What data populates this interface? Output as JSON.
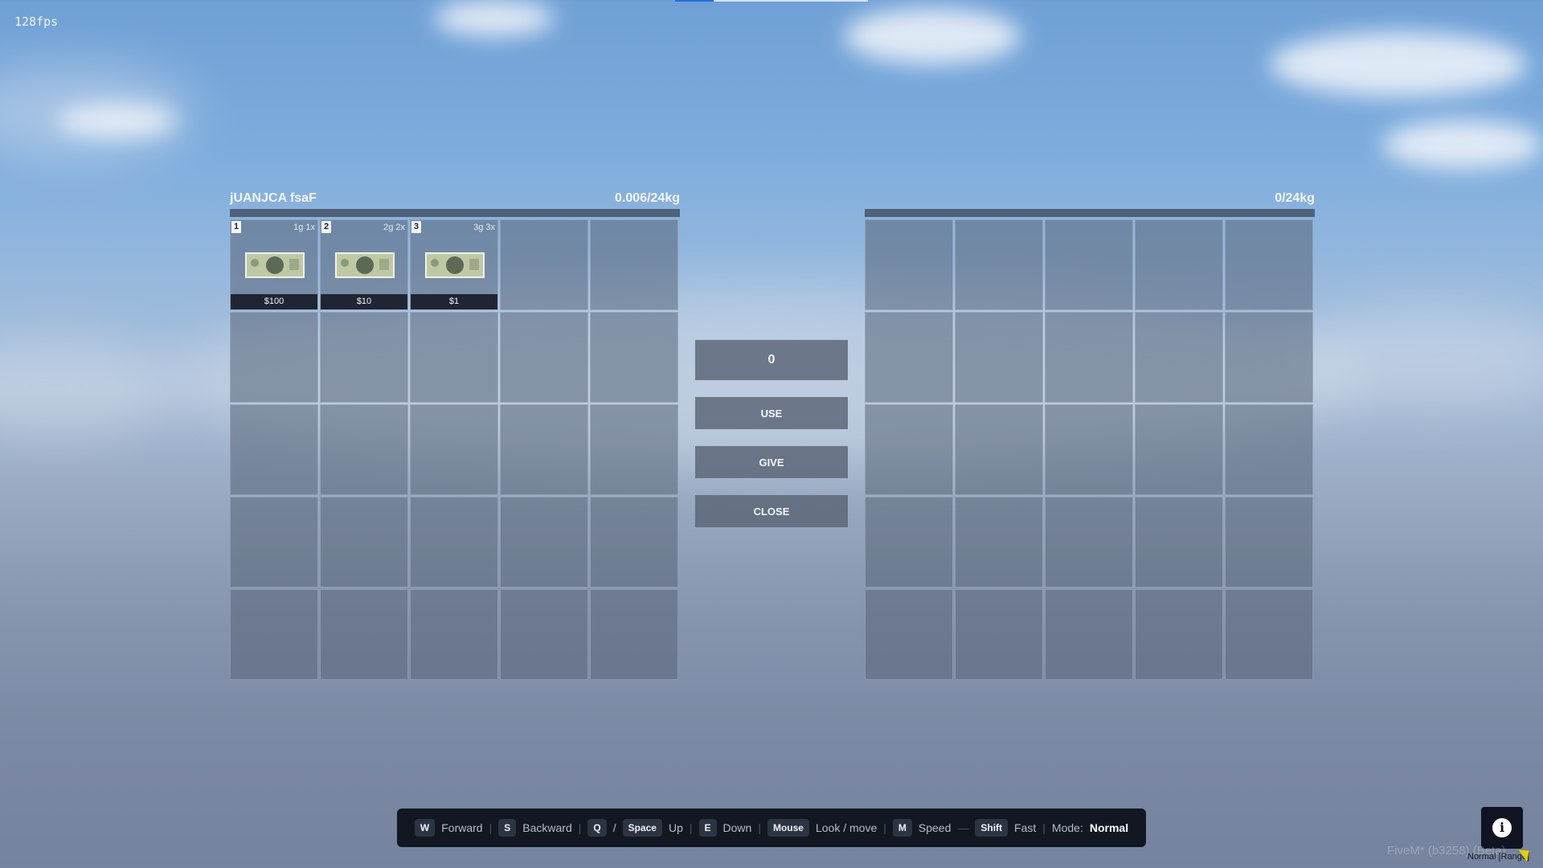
{
  "hud": {
    "fps": "128fps"
  },
  "left_inventory": {
    "title": "jUANJCA fsaF",
    "weight": "0.006/24kg",
    "items": [
      {
        "slot": "1",
        "meta": "1g 1x",
        "price": "$100",
        "icon": "hundred-dollar-bill-icon"
      },
      {
        "slot": "2",
        "meta": "2g 2x",
        "price": "$10",
        "icon": "ten-dollar-bill-icon"
      },
      {
        "slot": "3",
        "meta": "3g 3x",
        "price": "$1",
        "icon": "one-dollar-bill-icon"
      }
    ]
  },
  "right_inventory": {
    "title": "",
    "weight": "0/24kg"
  },
  "controls": {
    "amount": "0",
    "use": "USE",
    "give": "GIVE",
    "close": "CLOSE"
  },
  "help_bar": {
    "w": "W",
    "forward": "Forward",
    "s": "S",
    "backward": "Backward",
    "q": "Q",
    "slash": "/",
    "space": "Space",
    "up": "Up",
    "e": "E",
    "down": "Down",
    "mouse": "Mouse",
    "look": "Look / move",
    "m": "M",
    "speed": "Speed",
    "dash": "—",
    "shift": "Shift",
    "fast": "Fast",
    "mode_label": "Mode:",
    "mode_value": "Normal"
  },
  "footer": {
    "watermark": "FiveM* (b3258) (Beta)",
    "mode_tag": "Normal [Range]",
    "info_icon": "info-icon"
  },
  "colors": {
    "accent": "#1f6fe0",
    "panel": "#586478",
    "bar": "#121722"
  }
}
